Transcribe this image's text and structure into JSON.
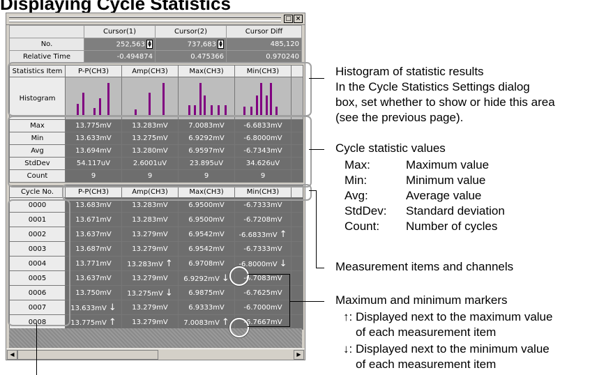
{
  "page_title": "Displaying Cycle Statistics",
  "window": {
    "max_btn": "□",
    "close_btn": "×"
  },
  "cursor_table": {
    "headers": [
      "",
      "Cursor(1)",
      "Cursor(2)",
      "Cursor Diff"
    ],
    "rows": [
      {
        "label": "No.",
        "c1": "252,563",
        "c2": "737,683",
        "diff": "485,120"
      },
      {
        "label": "Relative Time",
        "c1": "-0.494874",
        "c2": "0.475366",
        "diff": "0.970240"
      }
    ]
  },
  "stats": {
    "item_header": "Statistics Item",
    "columns": [
      "P-P(CH3)",
      "Amp(CH3)",
      "Max(CH3)",
      "Min(CH3)"
    ],
    "histogram_label": "Histogram",
    "histogram_color": "#800080",
    "rows": [
      {
        "label": "Max",
        "values": [
          "13.775mV",
          "13.283mV",
          "7.0083mV",
          "-6.6833mV"
        ]
      },
      {
        "label": "Min",
        "values": [
          "13.633mV",
          "13.275mV",
          "6.9292mV",
          "-6.8000mV"
        ]
      },
      {
        "label": "Avg",
        "values": [
          "13.694mV",
          "13.280mV",
          "6.9597mV",
          "-6.7343mV"
        ]
      },
      {
        "label": "StdDev",
        "values": [
          "54.117uV",
          "2.6001uV",
          "23.895uV",
          "34.626uV"
        ]
      },
      {
        "label": "Count",
        "values": [
          "9",
          "9",
          "9",
          "9"
        ]
      }
    ]
  },
  "cycles": {
    "header": "Cycle No.",
    "columns": [
      "P-P(CH3)",
      "Amp(CH3)",
      "Max(CH3)",
      "Min(CH3)"
    ],
    "rows": [
      {
        "no": "0000",
        "values": [
          "13.683mV",
          "13.283mV",
          "6.9500mV",
          "-6.7333mV"
        ],
        "marks": [
          "",
          "",
          "",
          ""
        ]
      },
      {
        "no": "0001",
        "values": [
          "13.671mV",
          "13.283mV",
          "6.9500mV",
          "-6.7208mV"
        ],
        "marks": [
          "",
          "",
          "",
          ""
        ]
      },
      {
        "no": "0002",
        "values": [
          "13.637mV",
          "13.279mV",
          "6.9542mV",
          "-6.6833mV"
        ],
        "marks": [
          "",
          "",
          "",
          "↑"
        ]
      },
      {
        "no": "0003",
        "values": [
          "13.687mV",
          "13.279mV",
          "6.9542mV",
          "-6.7333mV"
        ],
        "marks": [
          "",
          "",
          "",
          ""
        ]
      },
      {
        "no": "0004",
        "values": [
          "13.771mV",
          "13.283mV",
          "6.9708mV",
          "-6.8000mV"
        ],
        "marks": [
          "",
          "↑",
          "",
          "↓"
        ]
      },
      {
        "no": "0005",
        "values": [
          "13.637mV",
          "13.279mV",
          "6.9292mV",
          "-6.7083mV"
        ],
        "marks": [
          "",
          "",
          "↓",
          ""
        ]
      },
      {
        "no": "0006",
        "values": [
          "13.750mV",
          "13.275mV",
          "6.9875mV",
          "-6.7625mV"
        ],
        "marks": [
          "",
          "↓",
          "",
          ""
        ]
      },
      {
        "no": "0007",
        "values": [
          "13.633mV",
          "13.279mV",
          "6.9333mV",
          "-6.7000mV"
        ],
        "marks": [
          "↓",
          "",
          "",
          ""
        ]
      },
      {
        "no": "0008",
        "values": [
          "13.775mV",
          "13.279mV",
          "7.0083mV",
          "-6.7667mV"
        ],
        "marks": [
          "↑",
          "",
          "↑",
          ""
        ]
      }
    ]
  },
  "annotations": {
    "histogram": [
      "Histogram of statistic results",
      "In the Cycle Statistics Settings dialog",
      "box, set whether to show or hide this area",
      "(see the previous page)."
    ],
    "stat_values_title": "Cycle statistic values",
    "stat_defs": [
      {
        "term": "Max:",
        "desc": "Maximum value"
      },
      {
        "term": "Min:",
        "desc": "Minimum value"
      },
      {
        "term": "Avg:",
        "desc": "Average value"
      },
      {
        "term": "StdDev:",
        "desc": "Standard deviation"
      },
      {
        "term": "Count:",
        "desc": "Number of cycles"
      }
    ],
    "measurement": "Measurement items and channels",
    "markers_title": "Maximum and minimum markers",
    "max_marker": [
      "↑: Displayed next to the maximum value",
      "of each measurement item"
    ],
    "min_marker": [
      "↓: Displayed next to the minimum value",
      "of each measurement item"
    ]
  }
}
